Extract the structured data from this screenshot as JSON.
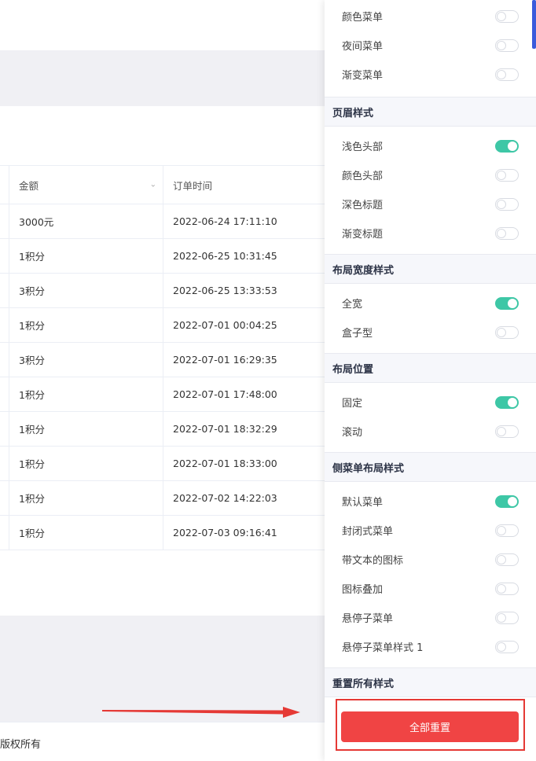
{
  "table": {
    "headers": [
      "金额",
      "订单时间"
    ],
    "rows": [
      {
        "amount": "3000元",
        "time": "2022-06-24 17:11:10"
      },
      {
        "amount": "1积分",
        "time": "2022-06-25 10:31:45"
      },
      {
        "amount": "3积分",
        "time": "2022-06-25 13:33:53"
      },
      {
        "amount": "1积分",
        "time": "2022-07-01 00:04:25"
      },
      {
        "amount": "3积分",
        "time": "2022-07-01 16:29:35"
      },
      {
        "amount": "1积分",
        "time": "2022-07-01 17:48:00"
      },
      {
        "amount": "1积分",
        "time": "2022-07-01 18:32:29"
      },
      {
        "amount": "1积分",
        "time": "2022-07-01 18:33:00"
      },
      {
        "amount": "1积分",
        "time": "2022-07-02 14:22:03"
      },
      {
        "amount": "1积分",
        "time": "2022-07-03 09:16:41"
      }
    ]
  },
  "footer": {
    "text": "版权所有"
  },
  "panel": {
    "top_options": [
      {
        "label": "颜色菜单",
        "on": false
      },
      {
        "label": "夜间菜单",
        "on": false
      },
      {
        "label": "渐变菜单",
        "on": false
      }
    ],
    "sections": [
      {
        "title": "页眉样式",
        "options": [
          {
            "label": "浅色头部",
            "on": true
          },
          {
            "label": "颜色头部",
            "on": false
          },
          {
            "label": "深色标题",
            "on": false
          },
          {
            "label": "渐变标题",
            "on": false
          }
        ]
      },
      {
        "title": "布局宽度样式",
        "options": [
          {
            "label": "全宽",
            "on": true
          },
          {
            "label": "盒子型",
            "on": false
          }
        ]
      },
      {
        "title": "布局位置",
        "options": [
          {
            "label": "固定",
            "on": true
          },
          {
            "label": "滚动",
            "on": false
          }
        ]
      },
      {
        "title": "侧菜单布局样式",
        "options": [
          {
            "label": "默认菜单",
            "on": true
          },
          {
            "label": "封闭式菜单",
            "on": false
          },
          {
            "label": "带文本的图标",
            "on": false
          },
          {
            "label": "图标叠加",
            "on": false
          },
          {
            "label": "悬停子菜单",
            "on": false
          },
          {
            "label": "悬停子菜单样式 1",
            "on": false
          }
        ]
      },
      {
        "title": "重置所有样式",
        "options": []
      }
    ],
    "reset_label": "全部重置"
  },
  "colors": {
    "toggle_on": "#3ec7a6",
    "reset_button": "#f04444",
    "annotation": "#e53935"
  }
}
